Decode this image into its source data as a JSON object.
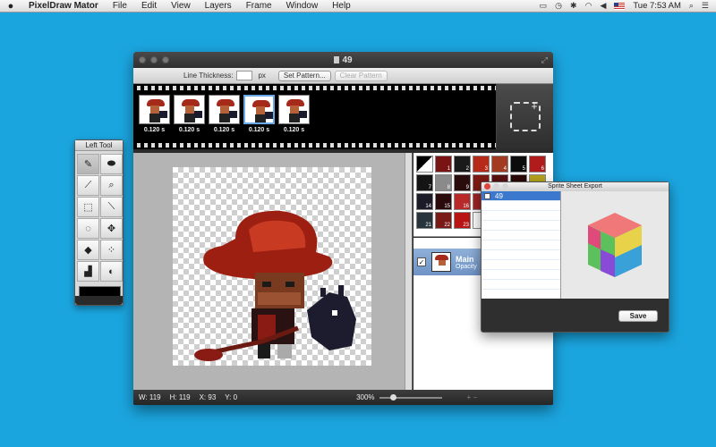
{
  "menubar": {
    "app_name": "PixelDraw Mator",
    "items": [
      "File",
      "Edit",
      "View",
      "Layers",
      "Frame",
      "Window",
      "Help"
    ],
    "clock": "Tue 7:53 AM"
  },
  "tool_palette": {
    "title": "Left Tool",
    "tools": [
      {
        "icon": "pencil-icon",
        "glyph": "✎"
      },
      {
        "icon": "eraser-icon",
        "glyph": "⬬"
      },
      {
        "icon": "eyedropper-icon",
        "glyph": "⟋"
      },
      {
        "icon": "magnifier-icon",
        "glyph": "⌕"
      },
      {
        "icon": "rect-select-icon",
        "glyph": "⬚"
      },
      {
        "icon": "wand-icon",
        "glyph": "⟍"
      },
      {
        "icon": "lasso-icon",
        "glyph": "◌"
      },
      {
        "icon": "move-icon",
        "glyph": "✥"
      },
      {
        "icon": "fill-bucket-icon",
        "glyph": "◆"
      },
      {
        "icon": "spray-icon",
        "glyph": "⁘"
      },
      {
        "icon": "brush-icon",
        "glyph": "▟"
      },
      {
        "icon": "shape-icon",
        "glyph": "◐"
      }
    ],
    "color": "#000000"
  },
  "window": {
    "title": "49",
    "toolbar": {
      "line_thickness_label": "Line Thickness:",
      "line_thickness_value": "",
      "unit": "px",
      "set_pattern": "Set Pattern...",
      "clear_pattern": "Clear Pattern"
    },
    "frames": [
      {
        "duration": "0.120 s"
      },
      {
        "duration": "0.120 s"
      },
      {
        "duration": "0.120 s"
      },
      {
        "duration": "0.120 s"
      },
      {
        "duration": "0.120 s"
      }
    ],
    "swatches": [
      {
        "n": "",
        "c": "#ffffff"
      },
      {
        "n": "1",
        "c": "#7a1414"
      },
      {
        "n": "2",
        "c": "#1a1a1a"
      },
      {
        "n": "3",
        "c": "#b82a18"
      },
      {
        "n": "4",
        "c": "#a33a22"
      },
      {
        "n": "5",
        "c": "#0c0c0c"
      },
      {
        "n": "6",
        "c": "#b01c1c"
      },
      {
        "n": "7",
        "c": "#141414"
      },
      {
        "n": "8",
        "c": "#8a8a8a"
      },
      {
        "n": "9",
        "c": "#2a0c0c"
      },
      {
        "n": "",
        "c": "#7e1a12"
      },
      {
        "n": "",
        "c": "#5a1010"
      },
      {
        "n": "",
        "c": "#2a0808"
      },
      {
        "n": "",
        "c": "#b6a21c"
      },
      {
        "n": "14",
        "c": "#1c1c28"
      },
      {
        "n": "15",
        "c": "#2a0a0a"
      },
      {
        "n": "16",
        "c": "#b82a2a"
      },
      {
        "n": "",
        "c": "#a32222"
      },
      {
        "n": "",
        "c": "#1a1a1a"
      },
      {
        "n": "",
        "c": "#7a7a7a"
      },
      {
        "n": "",
        "c": "#b0b0b0"
      },
      {
        "n": "21",
        "c": "#28343c"
      },
      {
        "n": "22",
        "c": "#7a1a16"
      },
      {
        "n": "23",
        "c": "#b81414"
      },
      {
        "n": "",
        "c": "#ffffff"
      },
      {
        "n": "",
        "c": "#ffffff"
      },
      {
        "n": "",
        "c": "#ffffff"
      },
      {
        "n": "",
        "c": "#ffffff"
      }
    ],
    "layer": {
      "name": "Main",
      "opacity": "Opacity",
      "checked": "✓"
    },
    "status": {
      "w": "W: 119",
      "h": "H: 119",
      "x": "X: 93",
      "y": "Y: 0",
      "zoom": "300%",
      "layer_btns": "+ −"
    }
  },
  "export": {
    "title": "Sprite Sheet Export",
    "items": [
      "49",
      "",
      "",
      "",
      "",
      "",
      "",
      "",
      "",
      ""
    ],
    "save": "Save"
  }
}
